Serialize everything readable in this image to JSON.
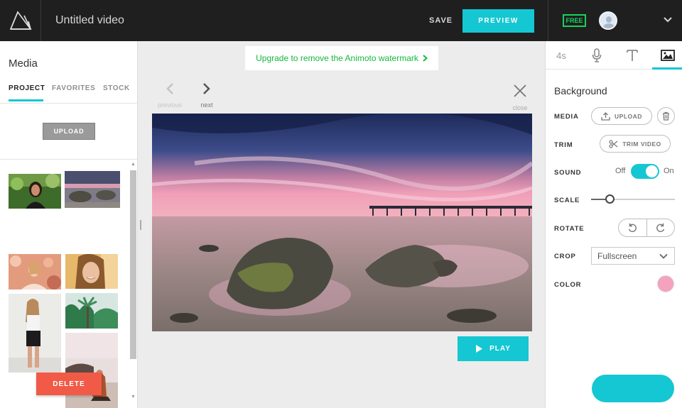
{
  "header": {
    "logo_icon": "animoto-logo-icon",
    "video_title": "Untitled video",
    "save_label": "SAVE",
    "preview_label": "PREVIEW",
    "plan_badge": "FREE",
    "account_icon": "chevron-down-icon"
  },
  "left_panel": {
    "title": "Media",
    "tabs": [
      {
        "label": "PROJECT",
        "active": true
      },
      {
        "label": "FAVORITES",
        "active": false
      },
      {
        "label": "STOCK",
        "active": false
      }
    ],
    "upload_label": "UPLOAD",
    "delete_label": "DELETE",
    "media_items": [
      "woman-portrait-green",
      "rocky-beach-sunset",
      "woman-in-flowers",
      "smiling-woman-close",
      "palm-trees-tropical",
      "woman-full-length",
      "woman-on-beach-rocks"
    ]
  },
  "center": {
    "watermark_notice": "Upgrade to remove the Animoto watermark",
    "prev_label": "previous",
    "next_label": "next",
    "close_label": "close",
    "play_label": "PLAY"
  },
  "right_panel": {
    "tabs": [
      {
        "label": "4s",
        "icon": "duration-icon"
      },
      {
        "label": "",
        "icon": "microphone-icon"
      },
      {
        "label": "",
        "icon": "text-icon"
      },
      {
        "label": "",
        "icon": "image-icon",
        "active": true
      }
    ],
    "title": "Background",
    "media_label": "MEDIA",
    "upload_label": "UPLOAD",
    "trim_label": "TRIM",
    "trim_button_label": "TRIM VIDEO",
    "sound_label": "SOUND",
    "sound_off": "Off",
    "sound_on": "On",
    "sound_enabled": true,
    "scale_label": "SCALE",
    "scale_value": 0.22,
    "rotate_label": "ROTATE",
    "crop_label": "CROP",
    "crop_value": "Fullscreen",
    "color_label": "COLOR",
    "color_value": "#f4a2bd"
  },
  "colors": {
    "accent": "#15c7d2",
    "delete": "#f05a47",
    "free_badge": "#19d15c",
    "watermark_text": "#14b83c",
    "topbar": "#1f1f1f"
  }
}
